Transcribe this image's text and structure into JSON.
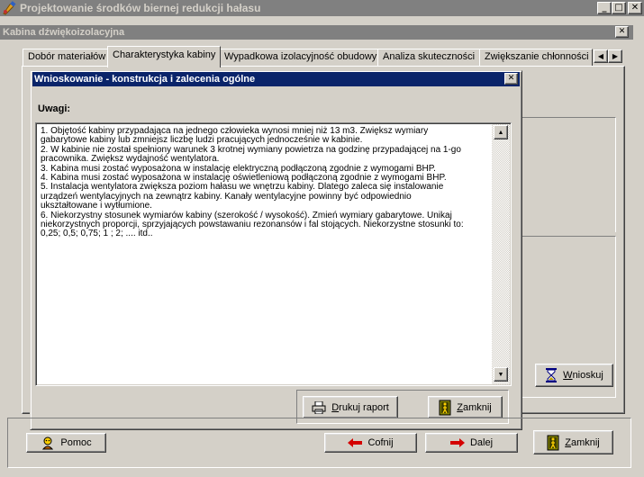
{
  "app": {
    "title": "Projektowanie środków biernej redukcji hałasu"
  },
  "child_window": {
    "title": "Kabina dźwiękoizolacyjna"
  },
  "tabs": [
    {
      "label": "Dobór materiałów"
    },
    {
      "label": "Charakterystyka kabiny",
      "active": true
    },
    {
      "label": "Wypadkowa izolacyjność obudowy"
    },
    {
      "label": "Analiza skuteczności"
    },
    {
      "label": "Zwiększanie chłonności"
    }
  ],
  "dialog": {
    "title": "Wnioskowanie - konstrukcja i zalecenia ogólne",
    "notes_label": "Uwagi:",
    "notes_text": "1. Objętość kabiny przypadająca na jednego człowieka wynosi mniej niż 13 m3. Zwiększ wymiary\ngabarytowe kabiny lub zmniejsz liczbę ludzi pracujących jednocześnie w kabinie.\n2. W kabinie nie został spełniony warunek 3 krotnej wymiany powietrza na godzinę przypadającej na 1-go\npracownika. Zwiększ wydajność wentylatora.\n3. Kabina musi zostać wyposażona w instalację elektryczną podłączoną zgodnie z wymogami BHP.\n4. Kabina musi zostać wyposażona w instalację oświetleniową podłączoną zgodnie z wymogami BHP.\n5. Instalacja wentylatora zwiększa poziom hałasu we wnętrzu kabiny. Dlatego zaleca się instalowanie\nurządzeń wentylacyjnych na zewnątrz kabiny. Kanały wentylacyjne powinny być odpowiednio\nukształtowane i wytłumione.\n6. Niekorzystny stosunek wymiarów kabiny (szerokość / wysokość). Zmień wymiary gabarytowe. Unikaj\nniekorzystnych proporcji, sprzyjających powstawaniu rezonansów i fal stojących. Niekorzystne stosunki to:\n0,25; 0,5; 0,75; 1 ; 2; .... itd..",
    "print_button": {
      "pre": "",
      "u": "D",
      "post": "rukuj raport"
    },
    "close_button": {
      "pre": "",
      "u": "Z",
      "post": "amknij"
    }
  },
  "right_panel": {
    "infer_button": {
      "pre": "",
      "u": "W",
      "post": "nioskuj"
    }
  },
  "bottom": {
    "help_label": "Pomoc",
    "back_label": "Cofnij",
    "next_label": "Dalej",
    "close_button": {
      "pre": "",
      "u": "Z",
      "post": "amknij"
    }
  },
  "colors": {
    "active_caption": "#0a246a",
    "inactive_caption": "#808080",
    "face": "#d4d0c8",
    "arrow_red": "#d40000"
  },
  "icons": [
    "app-icon",
    "minimize-icon",
    "maximize-icon",
    "close-icon",
    "printer-icon",
    "door-exit-icon",
    "hourglass-icon",
    "help-icon",
    "arrow-left-icon",
    "arrow-right-icon",
    "scroll-up-icon",
    "scroll-down-icon",
    "tab-scroll-left-icon",
    "tab-scroll-right-icon"
  ]
}
